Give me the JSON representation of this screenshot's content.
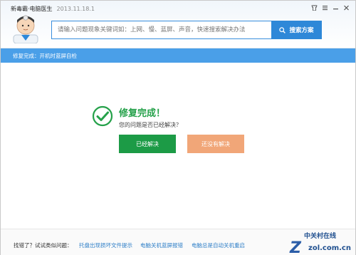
{
  "window": {
    "app_title": "新毒霸·电脑医生",
    "version": "2013.11.18.1"
  },
  "search": {
    "placeholder": "请输入问题现象关键词如：上网、慢、蓝屏、声音，快速搜索解决办法",
    "button_label": "搜索方案"
  },
  "breadcrumb": {
    "text": "修复完成：开机时蓝屏自检"
  },
  "result": {
    "title": "修复完成！",
    "question": "您的问题是否已经解决？",
    "solved_label": "已经解决",
    "unsolved_label": "还没有解决"
  },
  "footer": {
    "label": "找错了？试试类似问题：",
    "links": [
      "托盘出现损坏文件提示",
      "电脑关机蓝屏报错",
      "电脑总是自动关机重启"
    ]
  },
  "watermark": {
    "brand_top": "中关村在线",
    "brand_bottom": "zol.com.cn"
  },
  "colors": {
    "accent_blue": "#2e88d8",
    "success_green": "#25a14a",
    "solved_button": "#1c9b46",
    "unsolved_button": "#f1a678"
  }
}
